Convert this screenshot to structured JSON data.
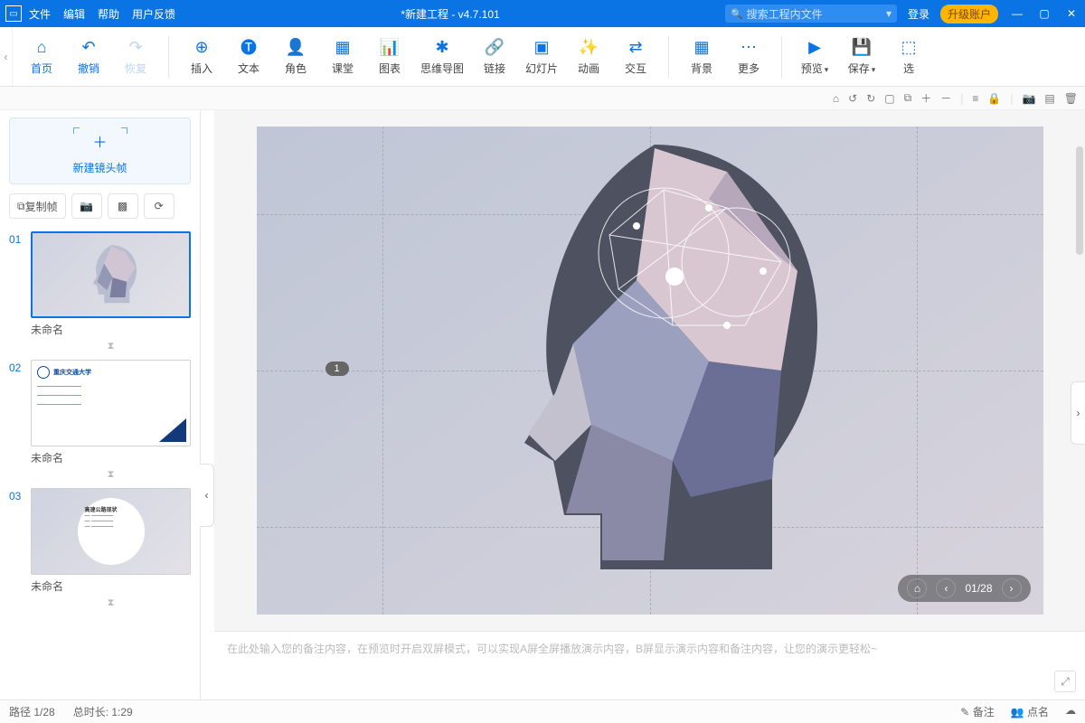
{
  "menubar": {
    "file": "文件",
    "edit": "编辑",
    "help": "帮助",
    "feedback": "用户反馈"
  },
  "title": "*新建工程 - v4.7.101",
  "search": {
    "placeholder": "搜索工程内文件"
  },
  "titlebar": {
    "login": "登录",
    "upgrade": "升级账户"
  },
  "ribbon": {
    "home": "首页",
    "undo": "撤销",
    "redo": "恢复",
    "insert": "插入",
    "text": "文本",
    "role": "角色",
    "class": "课堂",
    "chart": "图表",
    "mindmap": "思维导图",
    "link": "链接",
    "slide": "幻灯片",
    "anim": "动画",
    "interact": "交互",
    "background": "背景",
    "more": "更多",
    "preview": "预览",
    "save": "保存",
    "select": "选"
  },
  "sidebar": {
    "newframe": "新建镜头帧",
    "copyframe": "复制帧",
    "slides": [
      {
        "num": "01",
        "title": "未命名"
      },
      {
        "num": "02",
        "title": "未命名"
      },
      {
        "num": "03",
        "title": "未命名"
      }
    ],
    "slide2_heading": "重庆交通大学",
    "slide3_heading": "高速公路现状"
  },
  "stage": {
    "indicator": "1",
    "nav_counter": "01/28"
  },
  "notes": {
    "placeholder": "在此处输入您的备注内容，在预览时开启双屏模式，可以实现A屏全屏播放演示内容，B屏显示演示内容和备注内容，让您的演示更轻松~"
  },
  "status": {
    "path": "路径 1/28",
    "duration": "总时长: 1:29",
    "remark": "备注",
    "roll": "点名"
  }
}
